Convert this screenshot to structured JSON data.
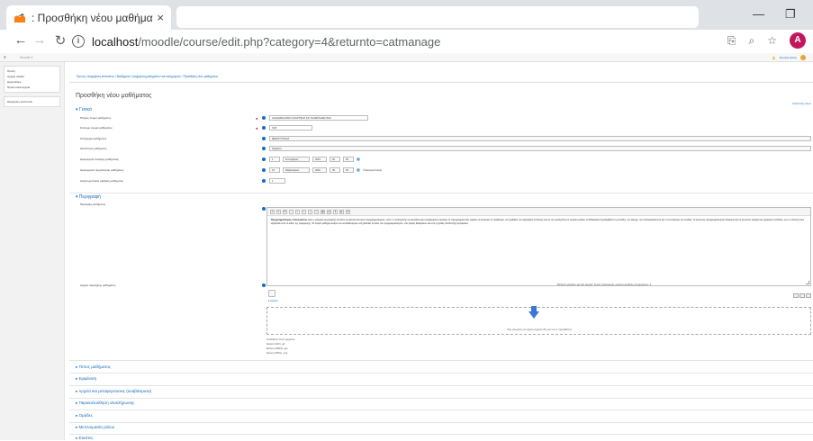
{
  "browser": {
    "tab_title": ": Προσθήκη νέου μαθήματος",
    "tab_close": "×",
    "url_host": "localhost",
    "url_path": "/moodle/course/edit.php?category=4&returnto=catmanage",
    "avatar_letter": "A",
    "minimize": "—",
    "restore": "❐"
  },
  "moodle_header": {
    "brand": "Moodle ▾",
    "user_name": "Ιάκωβος Ελίας"
  },
  "drawer": {
    "items": [
      "Πρώτη",
      "Αρχική σελίδα",
      "Ημερολόγιο",
      "Προσωπικά αρχεία"
    ],
    "admin": "Διαχείριση ιστότοπου"
  },
  "breadcrumb": "Πρώτη / Διαχείριση ιστότοπου / Μαθήματα / Διαχείριση μαθημάτων και κατηγοριών / Προσθήκη νέου μαθήματος",
  "page_title": "Προσθήκη νέου μαθήματος",
  "expand_all": "Ανάπτυξη όλων",
  "general": {
    "heading": "Γενικά",
    "fullname_label": "Πλήρες όνομα μαθήματος",
    "fullname_value": "ΑΚΑΔΗΜΙΑ ΕΠΙΚΙ ΚΑΤΑΡΤΙΣΗΣ ΚΑΙ ΤΗΛΕΚΠΑΙΔΕΥΣΗΣ",
    "shortname_label": "Σύντομο όνομα μαθήματος",
    "shortname_value": "SVR",
    "category_label": "Κατηγορία μαθήματος",
    "category_value": "ΜΕΣΟΙΤΥΧΙΑΚΑ",
    "visibility_label": "Ορατότητα μαθήματος",
    "visibility_value": "Προβολή",
    "startdate_label": "Ημερομηνία έναρξης μαθήματος",
    "start_day": "1",
    "start_month": "Σεπτέμβριος",
    "start_year": "2019",
    "start_hour": "00",
    "start_min": "00",
    "enddate_label": "Ημερομηνία τερματισμού μαθήματος",
    "end_day": "15",
    "end_month": "Φεβρουάριος",
    "end_year": "2020",
    "end_hour": "00",
    "end_min": "00",
    "enable_label": "Ενεργοποίηση",
    "idnumber_label": "Αναγνωριστικός αριθμός μαθήματος",
    "idnumber_value": "1"
  },
  "description": {
    "heading": "Περιγραφή",
    "summary_label": "Περίληψη μαθήματος",
    "summary_lead": "Προγραμματισμός υπολογιστών",
    "summary_text": " είναι η ενέργεια συγγραφής εντολών σε κάποια γλώσσα προγραμματισμού, ώστε ο υπολογιστής να εκτελέσει μια συγκεκριμένη εργασία. Ο προγραμματιστής οφείλει να κατανοεί το πρόβλημα, να σχεδιάζει τον αλγόριθμο επίλυσης και να τον μετατρέπει σε πηγαίο κώδικα. Η διαδικασία περιλαμβάνει τη σύνταξη, τον έλεγχο, την αποσφαλμάτωση και τη συντήρηση του κώδικα. Οι γλώσσες προγραμματισμού διακρίνονται σε γλώσσες υψηλού και χαμηλού επιπέδου, ενώ η επιλογή τους εξαρτάται από το είδος της εφαρμογής. Το παρόν μάθημα εισάγει τον εκπαιδευόμενο στις βασικές έννοιες του προγραμματισμού, στις δομές δεδομένων και στις τεχνικές ανάπτυξης λογισμικού.",
    "files_label": "Αρχεία περίληψης μαθήματος",
    "files_meta": "Μέγιστο μέγεθος για νέα αρχεία: Χωρίς περιορισμό, μέγιστο αριθμός συνημμένων: 1",
    "folder": "Αρχεία",
    "drop_text": "Σας μπορείτε να σύρετε αρχεία εδώ για να τα προσθέσετε.",
    "accepted_title": "Αποδεκτοί τύποι αρχείων:",
    "accepted": [
      "Εικόνα (GIF) .gif",
      "Εικόνα (JPEG) .jpe",
      "Εικόνα (PNG) .png"
    ]
  },
  "collapsed_sections": [
    "Τύπος μαθήματος",
    "Εμφάνιση",
    "Αρχεία και μεταφορτώσεις (αναβάσματα)",
    "Παρακολούθηση ολοκλήρωσης",
    "Ομάδες",
    "Μετονομασία ρόλου",
    "Ετικέτες"
  ],
  "toolbar": [
    "A",
    "A",
    "B",
    "I",
    "≡",
    "≡",
    "⚭",
    "⚯",
    "▣",
    "▤",
    "⬇",
    "▶",
    "⊞"
  ]
}
